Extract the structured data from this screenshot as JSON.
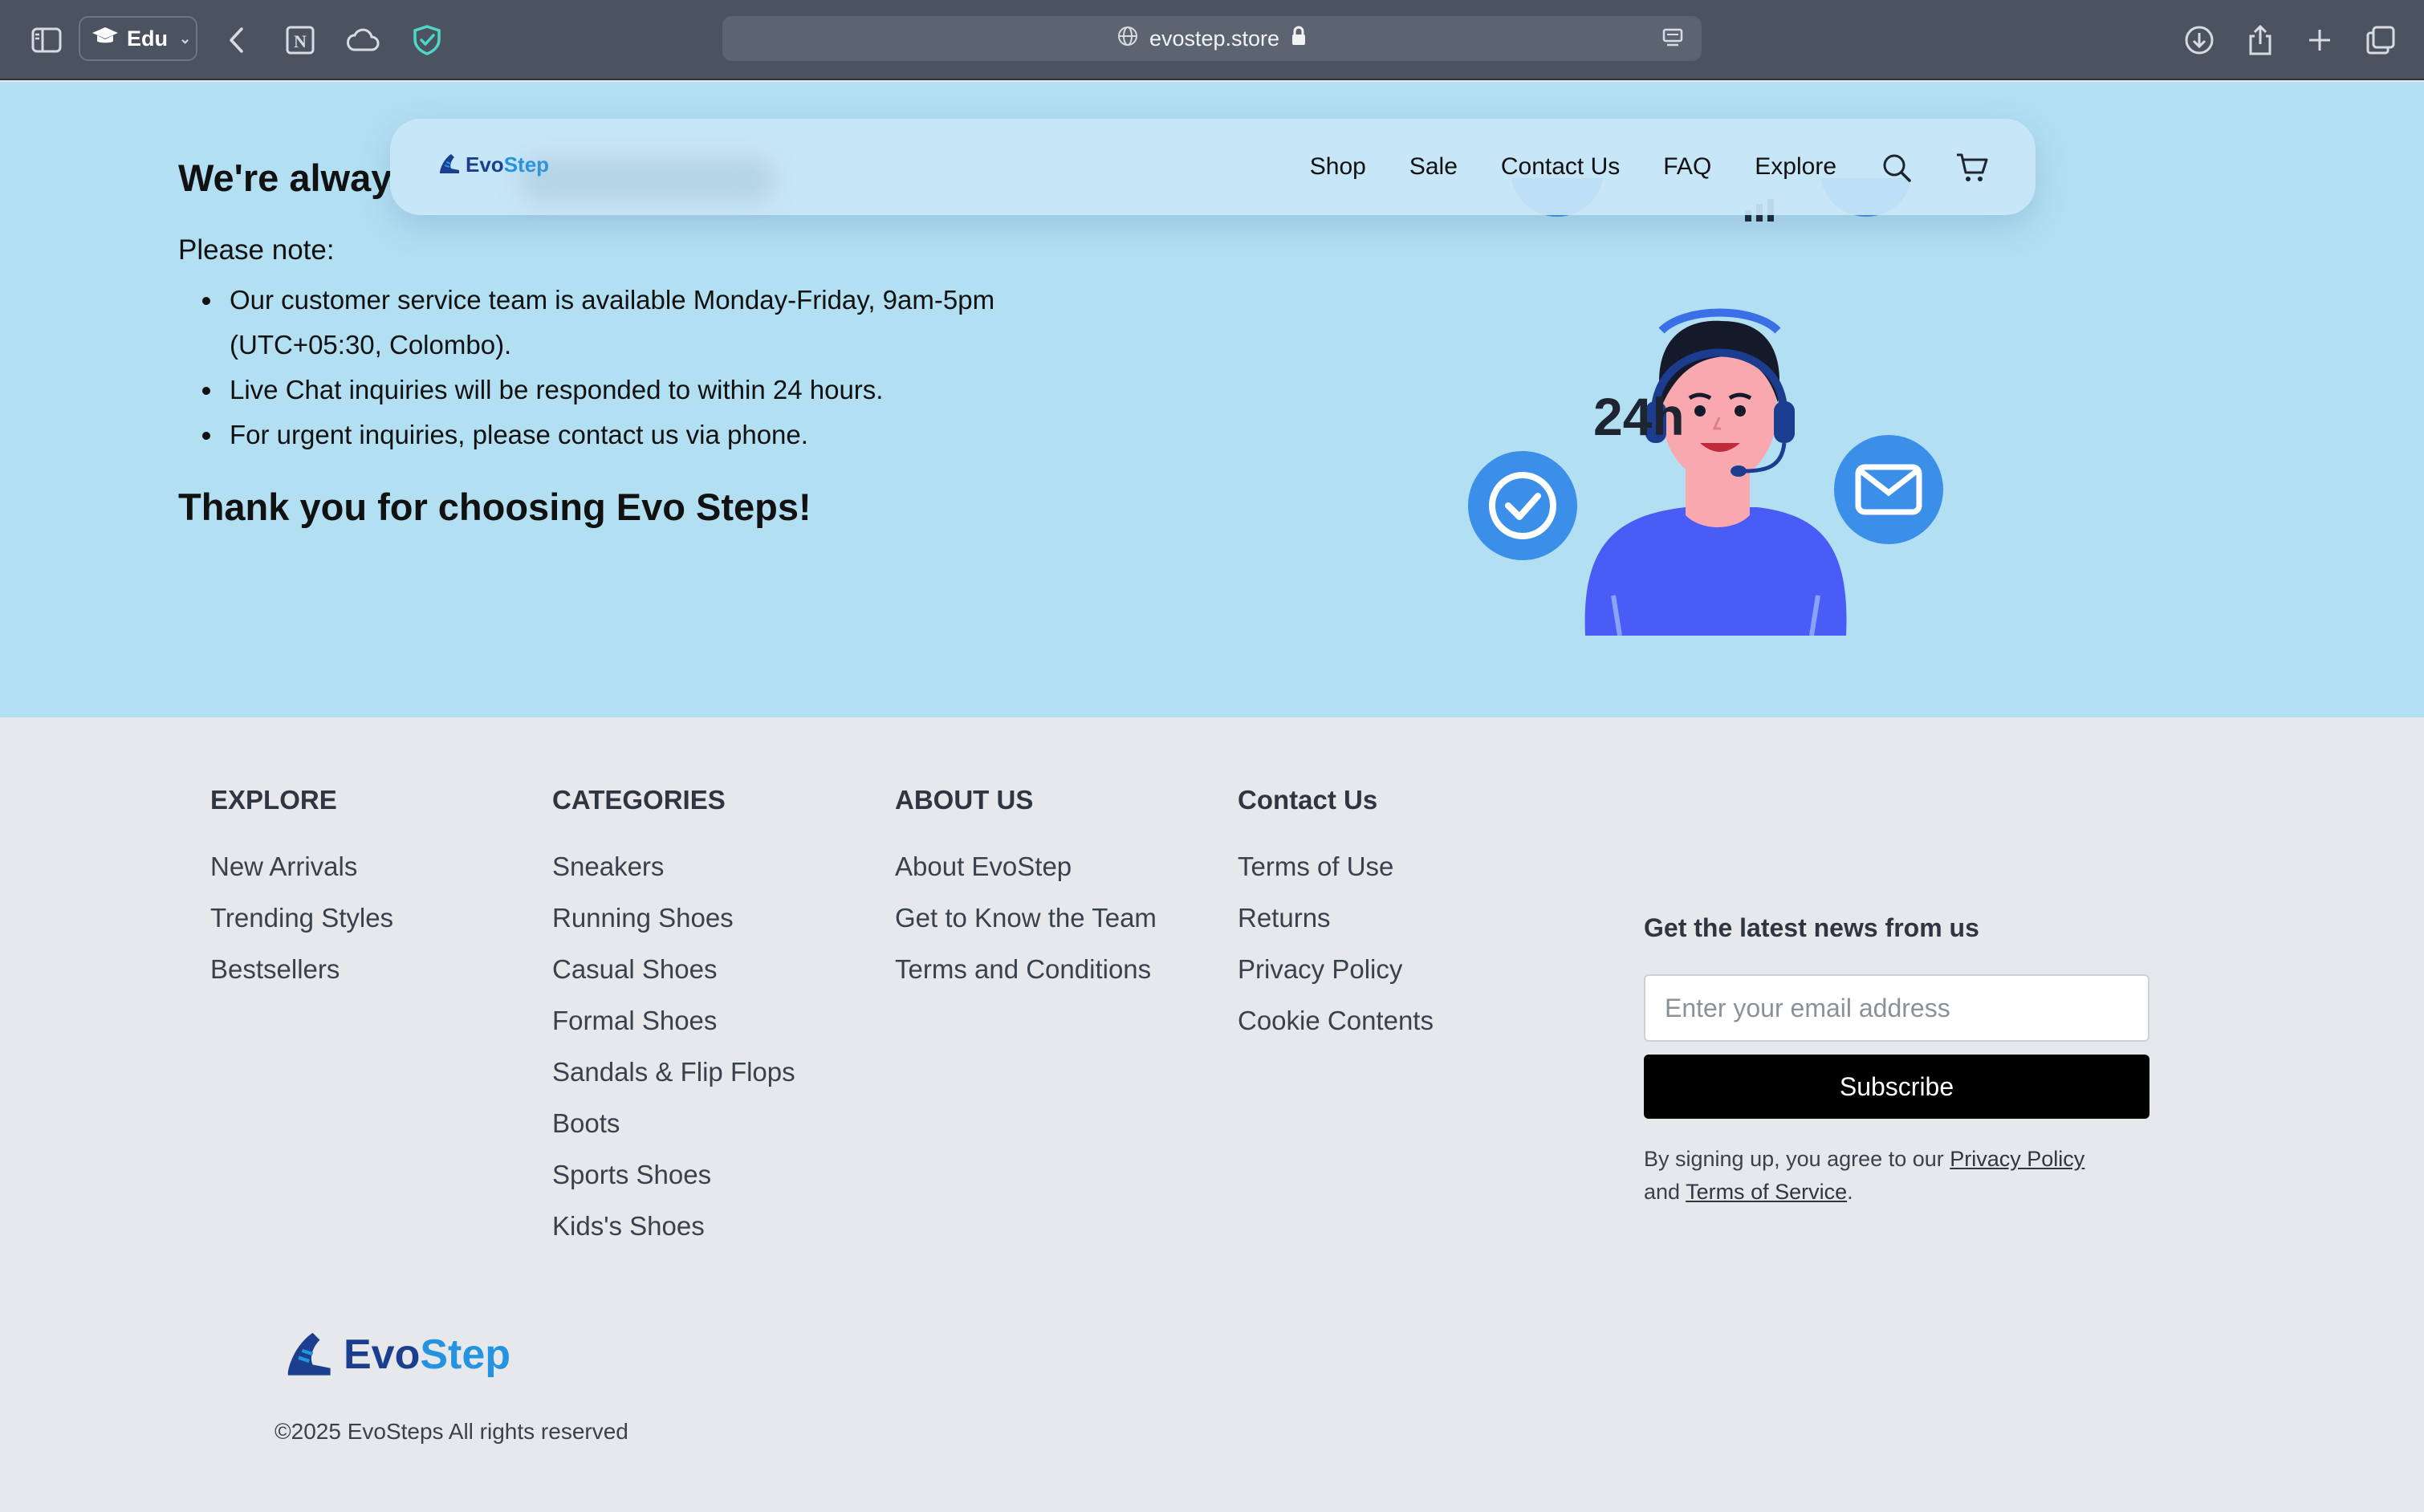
{
  "browser": {
    "profile_label": "Edu",
    "url": "evostep.store"
  },
  "hero": {
    "title_visible": "We're alway",
    "note_label": "Please note:",
    "notes": [
      "Our customer service team is available Monday-Friday, 9am-5pm (UTC+05:30, Colombo).",
      "Live Chat inquiries will be responded to within 24 hours.",
      "For urgent inquiries, please contact us via phone."
    ],
    "thanks": "Thank you for choosing Evo Steps!",
    "illustration_text": "24h"
  },
  "nav": {
    "logo_evo": "Evo",
    "logo_step": "Step",
    "links": [
      "Shop",
      "Sale",
      "Contact Us",
      "FAQ",
      "Explore"
    ]
  },
  "footer": {
    "columns": [
      {
        "title": "EXPLORE",
        "items": [
          "New Arrivals",
          "Trending Styles",
          "Bestsellers"
        ]
      },
      {
        "title": "CATEGORIES",
        "items": [
          "Sneakers",
          "Running Shoes",
          "Casual Shoes",
          "Formal Shoes",
          "Sandals & Flip Flops",
          "Boots",
          "Sports Shoes",
          "Kids's Shoes"
        ]
      },
      {
        "title": "ABOUT US",
        "items": [
          "About EvoStep",
          "Get to Know the Team",
          "Terms and Conditions"
        ]
      },
      {
        "title": "Contact Us",
        "items": [
          "Terms of Use",
          "Returns",
          "Privacy Policy",
          "Cookie Contents"
        ]
      }
    ],
    "newsletter": {
      "title": "Get the latest news from us",
      "placeholder": "Enter your email address",
      "button": "Subscribe",
      "legal_prefix": "By signing up, you agree to our ",
      "privacy_link": "Privacy Policy",
      "legal_and": "and ",
      "terms_link": "Terms of Service",
      "legal_suffix": "."
    },
    "logo_evo": "Evo",
    "logo_step": "Step",
    "copyright": "©2025 EvoSteps All rights reserved"
  },
  "colors": {
    "hero_bg": "#b3dff3",
    "footer_bg": "#e7e8eb",
    "brand_dark": "#1b3f8e",
    "brand_light": "#2494e0",
    "icon_blue": "#3b8fe8"
  }
}
